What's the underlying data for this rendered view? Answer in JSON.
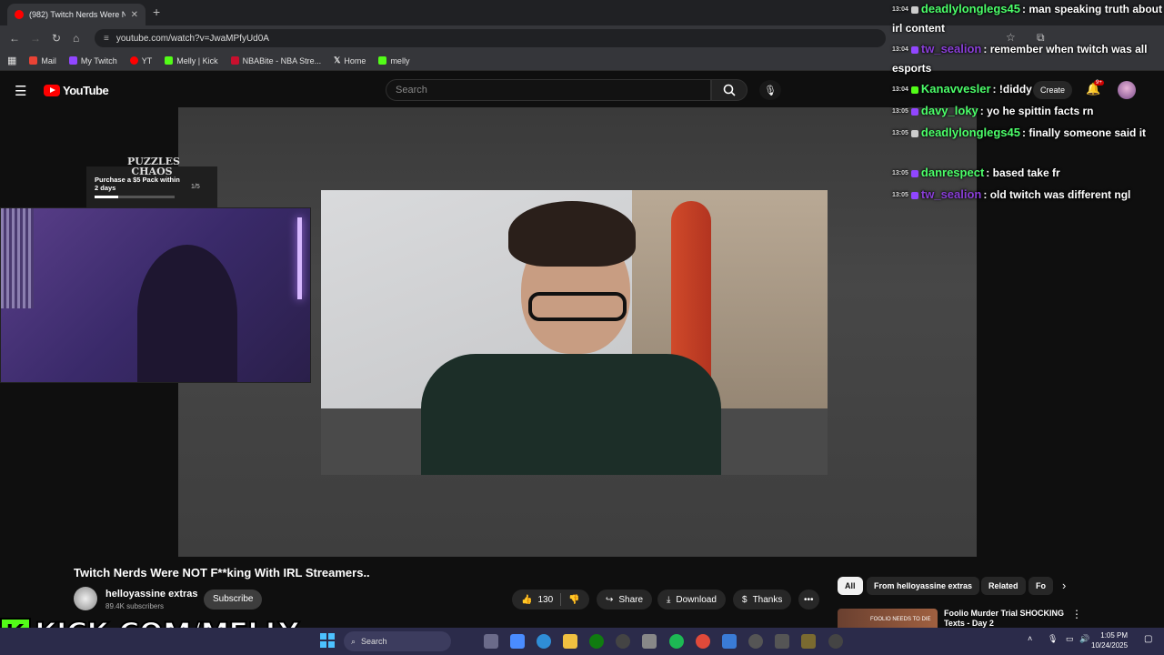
{
  "browser": {
    "tab_title": "(982) Twitch Nerds Were N...",
    "tab_close": "✕",
    "new_tab": "+",
    "url": "youtube.com/watch?v=JwaMPfyUd0A",
    "bookmarks": [
      {
        "label": "Mail",
        "color": "#ea4335"
      },
      {
        "label": "My Twitch",
        "color": "#9146ff"
      },
      {
        "label": "YT",
        "color": "#ff0000"
      },
      {
        "label": "Melly | Kick",
        "color": "#53fc18"
      },
      {
        "label": "NBABite - NBA Stre...",
        "color": "#c8102e"
      },
      {
        "label": "Home",
        "color": "#ffffff"
      },
      {
        "label": "melly",
        "color": "#53fc18"
      }
    ]
  },
  "youtube": {
    "logo_text": "YouTube",
    "search_placeholder": "Search",
    "create_label": "Create",
    "notif_badge": "9+"
  },
  "alert": {
    "logo": "PUZZLES CHAOS",
    "text": "Purchase a $5 Pack within 2 days",
    "count": "1/5",
    "progress": 0.3
  },
  "chat": [
    {
      "ts": "13:04",
      "badge": "s",
      "user": "deadlylonglegs45",
      "color": "#4cff6a",
      "msg": ": man speaking truth about irl content"
    },
    {
      "ts": "13:04",
      "badge": "p",
      "user": "tw_sealion",
      "color": "#8a3fd8",
      "msg": ": remember when twitch was all esports"
    },
    {
      "ts": "13:04",
      "badge": "k",
      "user": "Kanavvesler",
      "color": "#4cff6a",
      "msg": ": !diddy"
    },
    {
      "ts": "13:05",
      "badge": "p",
      "user": "davy_loky",
      "color": "#4cff6a",
      "msg": ": yo he spittin facts rn"
    },
    {
      "ts": "13:05",
      "badge": "s",
      "user": "deadlylonglegs45",
      "color": "#4cff6a",
      "msg": ": finally someone said it"
    },
    {
      "ts": "13:05",
      "badge": "p",
      "user": "danrespect",
      "color": "#4cff6a",
      "msg": ": based take fr"
    },
    {
      "ts": "13:05",
      "badge": "p",
      "user": "tw_sealion",
      "color": "#8a3fd8",
      "msg": ": old twitch was different ngl"
    }
  ],
  "video": {
    "title": "Twitch Nerds Were NOT F**king With IRL Streamers..",
    "channel": "helloyassine extras",
    "subscribers": "89.4K subscribers",
    "subscribe_label": "Subscribe",
    "likes": "130",
    "share_label": "Share",
    "download_label": "Download",
    "thanks_label": "Thanks",
    "more_label": "•••"
  },
  "chips": [
    "All",
    "From helloyassine extras",
    "Related",
    "Fo"
  ],
  "recommended": {
    "thumb_text": "FOOLIO NEEDS TO DIE",
    "title": "Foolio Murder Trial SHOCKING Texts - Day 2"
  },
  "overlay": {
    "kick_letter": "K",
    "kick_text": "KICK.COM/MELLY"
  },
  "taskbar": {
    "search_label": "Search",
    "time": "1:05 PM",
    "date": "10/24/2025"
  }
}
